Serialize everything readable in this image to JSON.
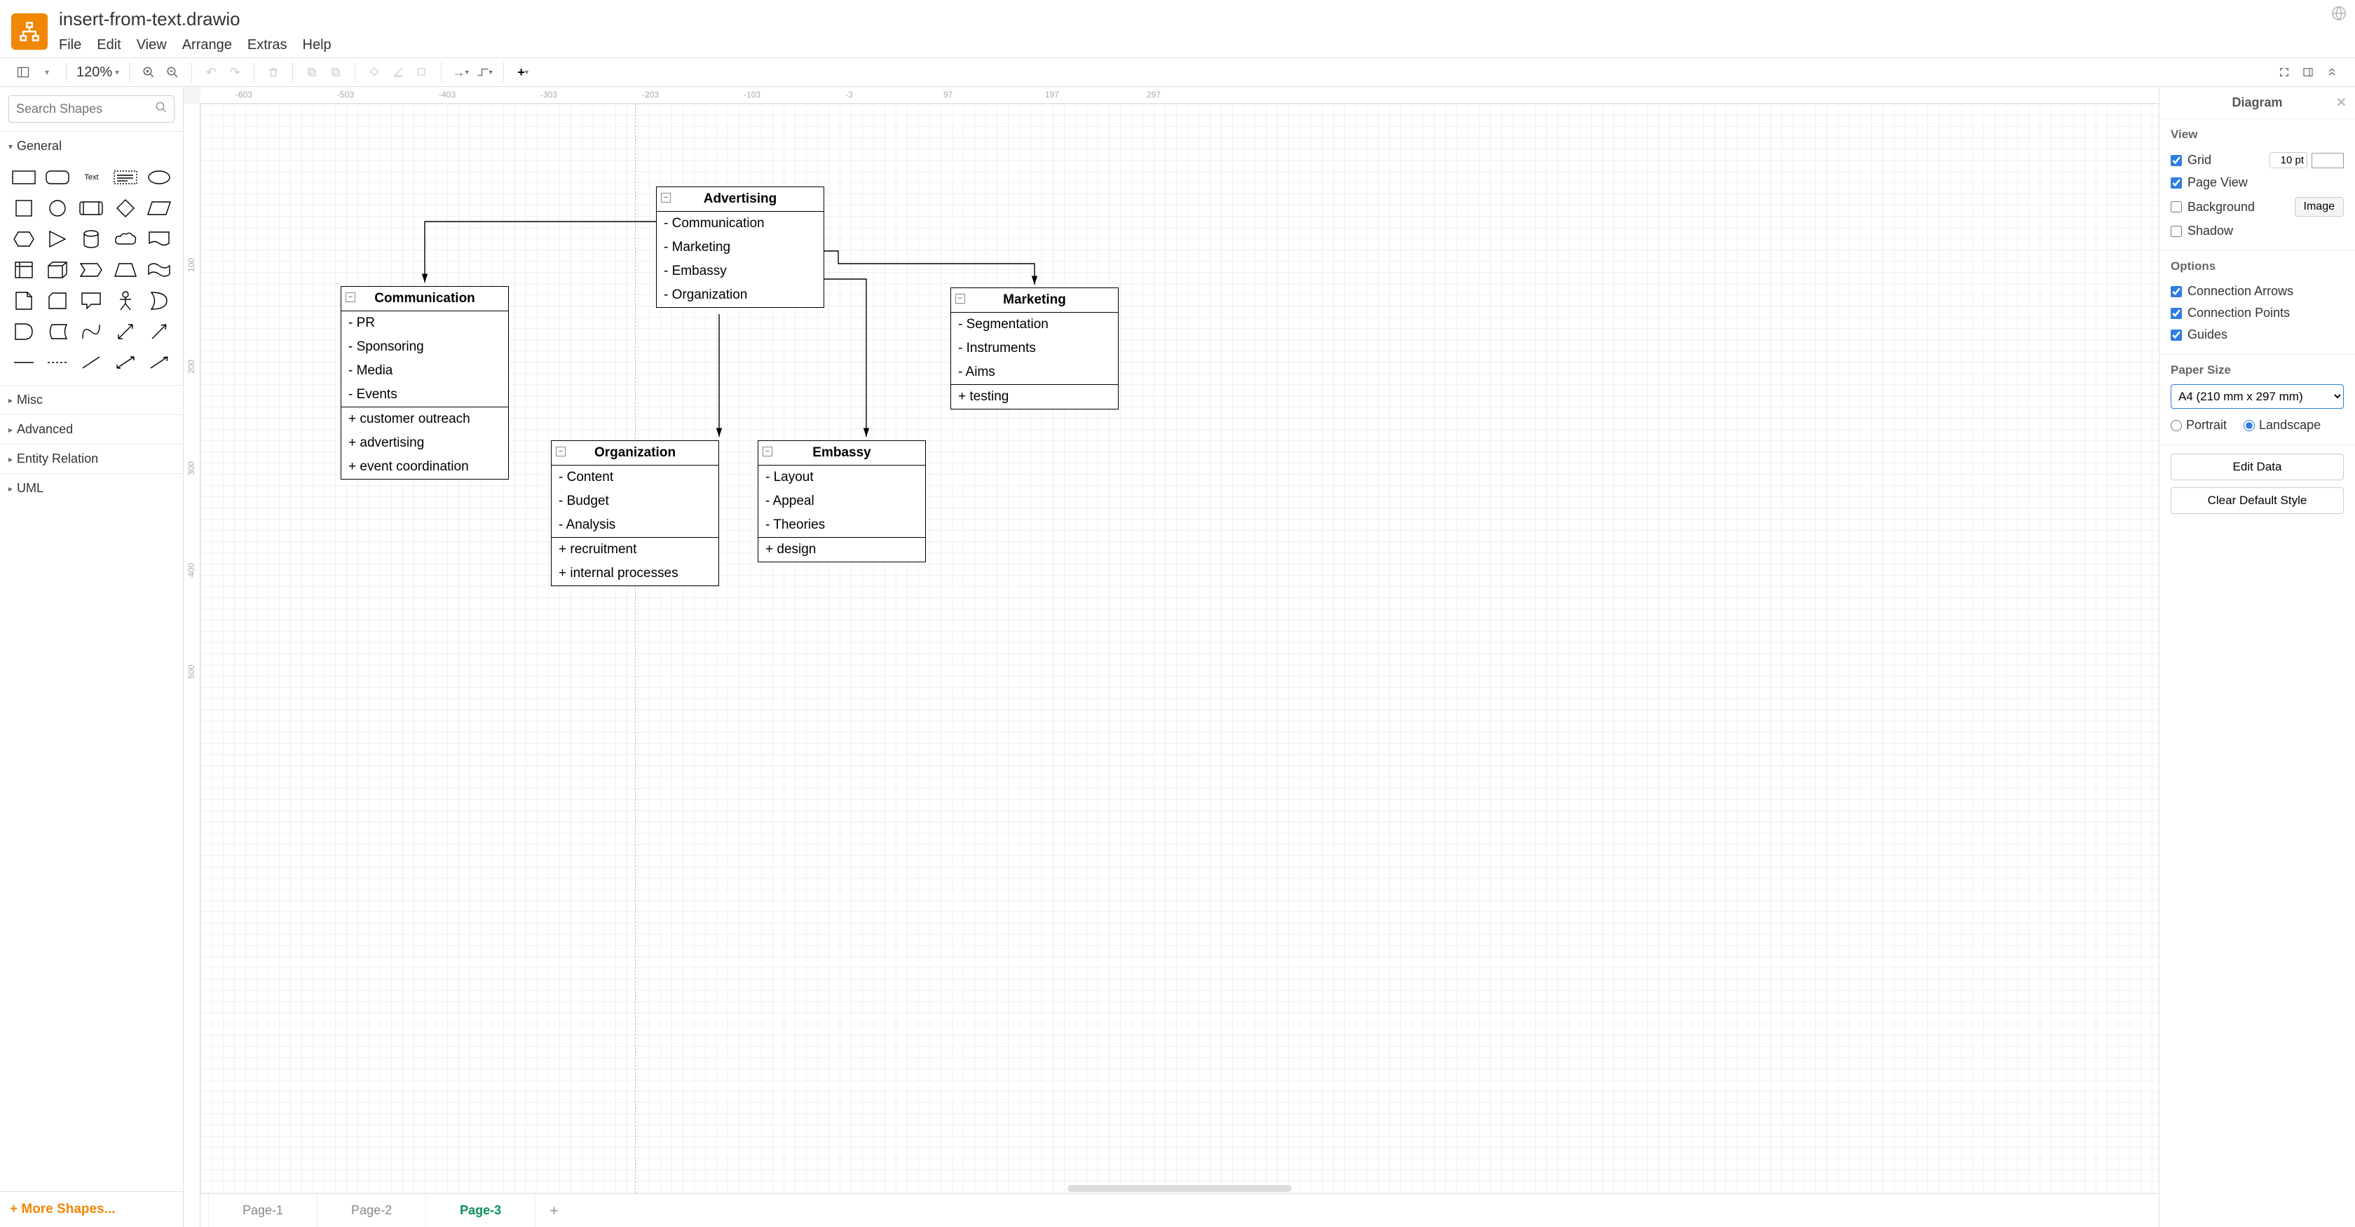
{
  "header": {
    "filename": "insert-from-text.drawio",
    "menu": [
      "File",
      "Edit",
      "View",
      "Arrange",
      "Extras",
      "Help"
    ]
  },
  "toolbar": {
    "zoom": "120%"
  },
  "left_sidebar": {
    "search_placeholder": "Search Shapes",
    "sections": {
      "general": "General",
      "misc": "Misc",
      "advanced": "Advanced",
      "entity_relation": "Entity Relation",
      "uml": "UML"
    },
    "more_shapes": "+ More Shapes..."
  },
  "ruler_h": [
    "-603",
    "-503",
    "-403",
    "-303",
    "-203",
    "-103",
    "-3",
    "97",
    "197",
    "297"
  ],
  "ruler_v": [
    "100",
    "200",
    "300",
    "400",
    "500"
  ],
  "diagram": {
    "boxes": {
      "advertising": {
        "title": "Advertising",
        "attrs": [
          "- Communication",
          "- Marketing",
          "- Embassy",
          "- Organization"
        ]
      },
      "communication": {
        "title": "Communication",
        "attrs": [
          "- PR",
          "- Sponsoring",
          "- Media",
          "- Events"
        ],
        "ops": [
          "+ customer outreach",
          "+ advertising",
          "+ event coordination"
        ]
      },
      "marketing": {
        "title": "Marketing",
        "attrs": [
          "- Segmentation",
          "- Instruments",
          "- Aims"
        ],
        "ops": [
          "+ testing"
        ]
      },
      "organization": {
        "title": "Organization",
        "attrs": [
          "- Content",
          "- Budget",
          "- Analysis"
        ],
        "ops": [
          "+ recruitment",
          "+ internal processes"
        ]
      },
      "embassy": {
        "title": "Embassy",
        "attrs": [
          "- Layout",
          "- Appeal",
          "- Theories"
        ],
        "ops": [
          "+ design"
        ]
      }
    }
  },
  "right_panel": {
    "title": "Diagram",
    "view_label": "View",
    "grid_label": "Grid",
    "grid_value": "10 pt",
    "page_view": "Page View",
    "background": "Background",
    "image_btn": "Image",
    "shadow": "Shadow",
    "options_label": "Options",
    "conn_arrows": "Connection Arrows",
    "conn_points": "Connection Points",
    "guides": "Guides",
    "paper_size_label": "Paper Size",
    "paper_size_value": "A4 (210 mm x 297 mm)",
    "portrait": "Portrait",
    "landscape": "Landscape",
    "edit_data": "Edit Data",
    "clear_style": "Clear Default Style"
  },
  "tabs": {
    "pages": [
      "Page-1",
      "Page-2",
      "Page-3"
    ],
    "active": 2
  }
}
